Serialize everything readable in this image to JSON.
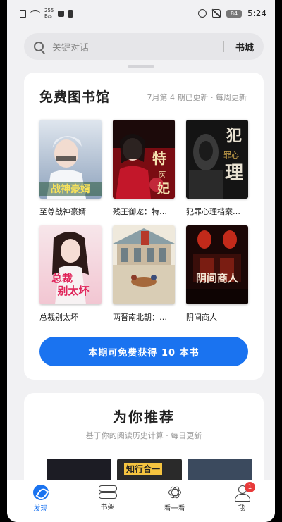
{
  "status_bar": {
    "net_speed_value": "255",
    "net_speed_unit": "B/s",
    "battery": "84",
    "time": "5:24"
  },
  "search": {
    "placeholder": "关键对话",
    "bookcity_label": "书城"
  },
  "free_library": {
    "title": "免费图书馆",
    "subtitle": "7月第 4 期已更新 · 每周更新",
    "books": [
      {
        "title": "至尊战神豪婿",
        "cover_text": "战神豪婿"
      },
      {
        "title": "残王御宠：特…",
        "cover_text": "特医妃"
      },
      {
        "title": "犯罪心理档案…",
        "cover_text": "犯罪心理"
      },
      {
        "title": "总裁别太坏",
        "cover_text": "总裁别太坏"
      },
      {
        "title": "两晋南北朝：…",
        "cover_text": ""
      },
      {
        "title": "阴间商人",
        "cover_text": "阴间商人"
      }
    ],
    "button_label": "本期可免费获得 10 本书"
  },
  "recommend": {
    "title": "为你推荐",
    "subtitle": "基于你的阅读历史计算 · 每日更新",
    "thumb_label": "知行合一"
  },
  "nav": {
    "items": [
      {
        "label": "发现",
        "icon": "discover-icon",
        "active": true
      },
      {
        "label": "书架",
        "icon": "bookshelf-icon"
      },
      {
        "label": "看一看",
        "icon": "look-icon"
      },
      {
        "label": "我",
        "icon": "me-icon",
        "badge": "1"
      }
    ]
  },
  "colors": {
    "accent": "#1a73f0",
    "badge": "#e83a3a"
  }
}
